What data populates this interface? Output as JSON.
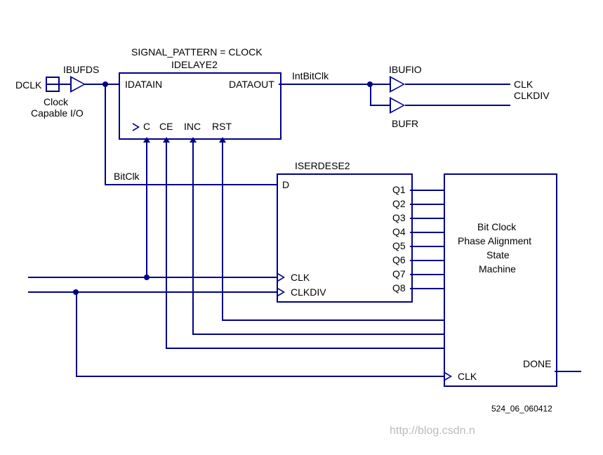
{
  "labels": {
    "dclk": "DCLK",
    "ibufds": "IBUFDS",
    "clock_capable_io1": "Clock",
    "clock_capable_io2": "Capable I/O",
    "signal_pattern": "SIGNAL_PATTERN = CLOCK",
    "idelaye2": "IDELAYE2",
    "idatain": "IDATAIN",
    "dataout": "DATAOUT",
    "c": "C",
    "ce": "CE",
    "inc": "INC",
    "rst": "RST",
    "intbitclk": "IntBitClk",
    "ibufio": "IBUFIO",
    "bufr": "BUFR",
    "clk_out": "CLK",
    "clkdiv_out": "CLKDIV",
    "bitclk": "BitClk",
    "iserdese2": "ISERDESE2",
    "d": "D",
    "q1": "Q1",
    "q2": "Q2",
    "q3": "Q3",
    "q4": "Q4",
    "q5": "Q5",
    "q6": "Q6",
    "q7": "Q7",
    "q8": "Q8",
    "clk_in": "CLK",
    "clkdiv_in": "CLKDIV",
    "sm1": "Bit Clock",
    "sm2": "Phase Alignment",
    "sm3": "State",
    "sm4": "Machine",
    "done": "DONE",
    "sm_clk": "CLK",
    "figref": "524_06_060412",
    "wm1": "http://blog.csdn.n",
    "wm2": ""
  }
}
